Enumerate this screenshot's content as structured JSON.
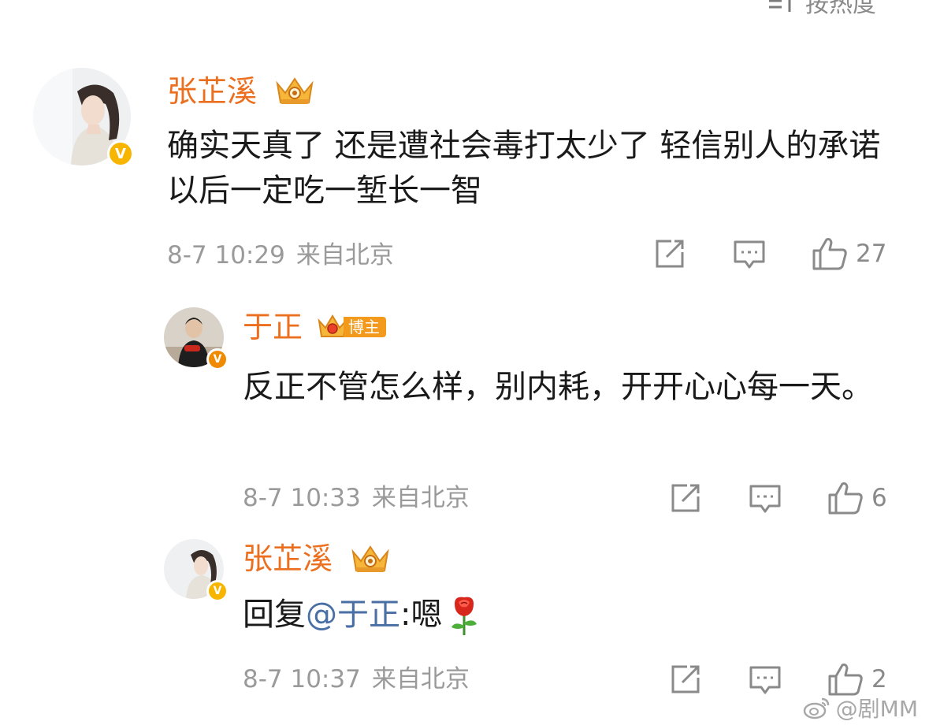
{
  "sort": {
    "label": "按热度"
  },
  "comments": [
    {
      "username": "张芷溪",
      "content": "确实天真了 还是遭社会毒打太少了 轻信别人的承诺 以后一定吃一堑长一智",
      "date": "8-7 10:29",
      "source": "来自北京",
      "likes": "27"
    },
    {
      "username": "于正",
      "tag": "博主",
      "content": "反正不管怎么样，别内耗，开开心心每一天。",
      "date": "8-7 10:33",
      "source": "来自北京",
      "likes": "6"
    },
    {
      "username": "张芷溪",
      "reply_prefix": "回复",
      "mention": "@于正",
      "reply_text": ":嗯",
      "date": "8-7 10:37",
      "source": "来自北京",
      "likes": "2"
    }
  ],
  "watermark": {
    "handle": "@剧MM"
  },
  "colors": {
    "username": "#eb6f1e",
    "mention": "#4a6fa5",
    "meta": "#9a9a9a",
    "verified_badge": "#f7b500"
  },
  "icons": [
    "sort-icon",
    "crown-icon",
    "verified-icon",
    "share-icon",
    "comment-icon",
    "like-icon",
    "rose-emoji-icon",
    "weibo-logo-icon"
  ]
}
